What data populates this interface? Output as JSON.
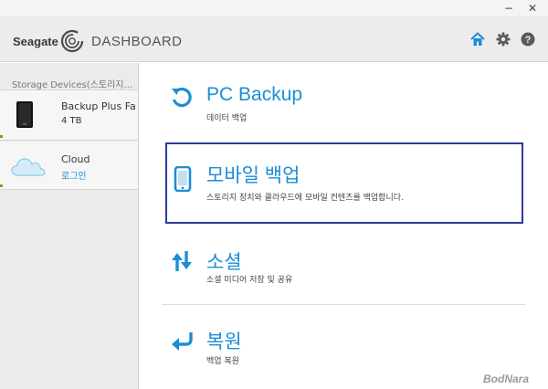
{
  "window": {
    "minimize_label": "−",
    "close_label": "✕"
  },
  "header": {
    "brand": "Seagate",
    "title": "DASHBOARD",
    "icons": [
      "home-icon",
      "gear-icon",
      "help-icon"
    ]
  },
  "sidebar": {
    "heading": "Storage Devices(스토리지...",
    "devices": [
      {
        "name": "Backup Plus Fa...",
        "sub": "4 TB",
        "icon": "drive-icon"
      },
      {
        "name": "Cloud",
        "sub": "로그인",
        "icon": "cloud-icon"
      }
    ]
  },
  "main": {
    "features": [
      {
        "title": "PC Backup",
        "desc": "데이터 백업",
        "icon": "refresh-icon"
      },
      {
        "title": "모바일 백업",
        "desc": "스토리지 장치와 클라우드에 모바일 컨텐츠를 백업합니다.",
        "icon": "phone-icon",
        "selected": true
      },
      {
        "title": "소셜",
        "desc": "소셜 미디어 저장 및 공유",
        "icon": "sync-arrows-icon"
      },
      {
        "title": "복원",
        "desc": "백업 복원",
        "icon": "restore-arrow-icon"
      }
    ]
  },
  "watermark": "BodNara",
  "colors": {
    "accent": "#1b8ed6",
    "selection_border": "#2b3a9c"
  }
}
